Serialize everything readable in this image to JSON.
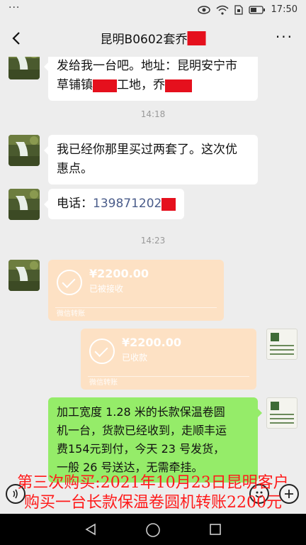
{
  "status_bar": {
    "dots": "···",
    "time": "17:50"
  },
  "header": {
    "title": "昆明B0602套乔",
    "back_icon": "chevron-left-icon",
    "more_icon": "more-dots-icon",
    "more_label": "···"
  },
  "messages": {
    "m1": {
      "line1": "发给我一台吧。地址：昆明安宁市",
      "line2_a": "草铺镇",
      "line2_b": "工地，乔"
    },
    "t1": "14:18",
    "m2": {
      "line1": "我已经你那里买过两套了。这次优",
      "line2": "惠点。"
    },
    "m3": {
      "label": "电话：",
      "number": "139871202"
    },
    "t2": "14:23",
    "tr1": {
      "amount": "¥2200.00",
      "status": "已被接收",
      "footer": "微信转账"
    },
    "tr2": {
      "amount": "¥2200.00",
      "status": "已收款",
      "footer": "微信转账"
    },
    "m4": {
      "line1": "加工宽度 1.28 米的长款保温卷圆",
      "line2": "机一台，货款已经收到，走顺丰运",
      "line3": "费154元到付，今天 23 号发货，",
      "line4": "一般 26 号送达，无需牵挂。"
    }
  },
  "caption": {
    "line1": "第三次购买:2021年10月23日昆明客户",
    "line2": "购买一台长款保温卷圆机转账2200元"
  },
  "input_bar": {
    "voice_icon": "voice-icon",
    "emoji_icon": "emoji-icon",
    "add_icon": "add-icon"
  },
  "system_nav": {
    "back": "back-triangle-icon",
    "home": "home-circle-icon",
    "recent": "recent-square-icon"
  },
  "colors": {
    "redact": "#e5101d",
    "caption": "#ff1a1a",
    "bubble_green": "#95ec69",
    "transfer": "#fde1c4"
  }
}
